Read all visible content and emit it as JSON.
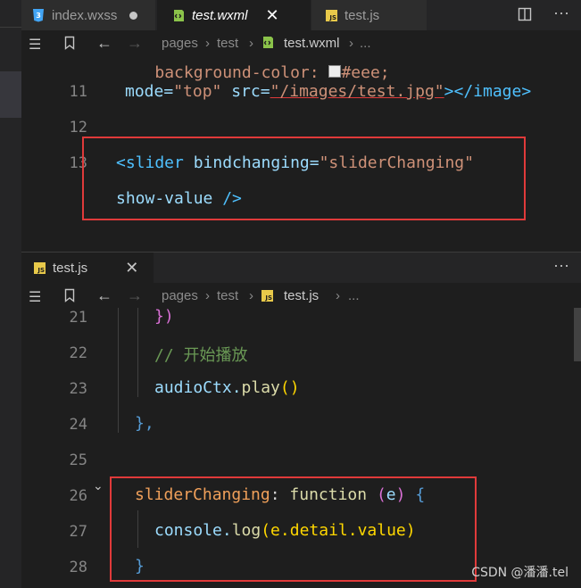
{
  "top_tabs": [
    {
      "label": "index.wxss",
      "icon": "css-icon",
      "status": "modified"
    },
    {
      "label": "test.wxml",
      "icon": "wxml-icon",
      "status": "active"
    },
    {
      "label": "test.js",
      "icon": "js-icon",
      "status": "inactive"
    }
  ],
  "top_breadcrumb": {
    "folder1": "pages",
    "folder2": "test",
    "file": "test.wxml",
    "tail": "..."
  },
  "top_code": {
    "partial_line": "background-color: ■#eee;",
    "partial_prop": "background-color:",
    "partial_val": "#eee;",
    "lines": [
      {
        "num": "11",
        "mode_attr": "mode=",
        "mode_val": "\"top\"",
        "src_attr": "src=",
        "src_val": "\"/images/test.jpg\"",
        "close": "></image>"
      },
      {
        "num": "12"
      },
      {
        "num": "13",
        "open": "<slider",
        "attr": "bindchanging=",
        "val": "\"sliderChanging\""
      },
      {
        "num": "",
        "attr2": "show-value",
        "close2": "/>"
      }
    ]
  },
  "bottom_tabs": [
    {
      "label": "test.js",
      "icon": "js-icon"
    }
  ],
  "bottom_breadcrumb": {
    "folder1": "pages",
    "folder2": "test",
    "file": "test.js",
    "tail": "..."
  },
  "bottom_code": {
    "lines": [
      {
        "num": "21",
        "text": "})"
      },
      {
        "num": "22",
        "text": "// 开始播放"
      },
      {
        "num": "23",
        "obj": "audioCtx.",
        "method": "play",
        "parens": "()"
      },
      {
        "num": "24",
        "text": "},"
      },
      {
        "num": "25"
      },
      {
        "num": "26",
        "name": "sliderChanging",
        "colon": ":",
        "kw": "function",
        "param_open": "(",
        "param": "e",
        "param_close": ")",
        "brace": "{"
      },
      {
        "num": "27",
        "obj": "console.",
        "method": "log",
        "arg": "(e.detail.value)"
      },
      {
        "num": "28",
        "text": "}"
      }
    ]
  },
  "watermark": "CSDN @潘潘.tel",
  "colors": {
    "highlight_box": "#e03a3a",
    "editor_bg": "#1e1e1e",
    "tab_bg": "#252526"
  }
}
